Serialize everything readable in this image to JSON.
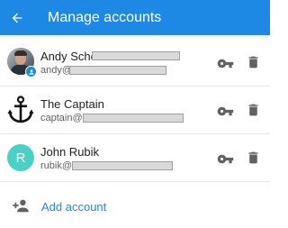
{
  "header": {
    "title": "Manage accounts",
    "back_icon": "arrow-left-icon"
  },
  "accounts": [
    {
      "name": "Andy Scher",
      "email_prefix": "andy@",
      "avatar": "photo",
      "badge_icon": "person-badge-icon"
    },
    {
      "name": "The Captain",
      "email_prefix": "captain@",
      "avatar": "anchor-icon"
    },
    {
      "name": "John Rubik",
      "email_prefix": "rubik@",
      "avatar_letter": "R",
      "avatar_color": "#4dd0c4"
    }
  ],
  "actions": {
    "key_icon": "key-icon",
    "delete_icon": "trash-icon"
  },
  "add_account": {
    "label": "Add account",
    "icon": "add-person-icon"
  },
  "colors": {
    "accent": "#1e88e5",
    "icon_gray": "#616161"
  }
}
